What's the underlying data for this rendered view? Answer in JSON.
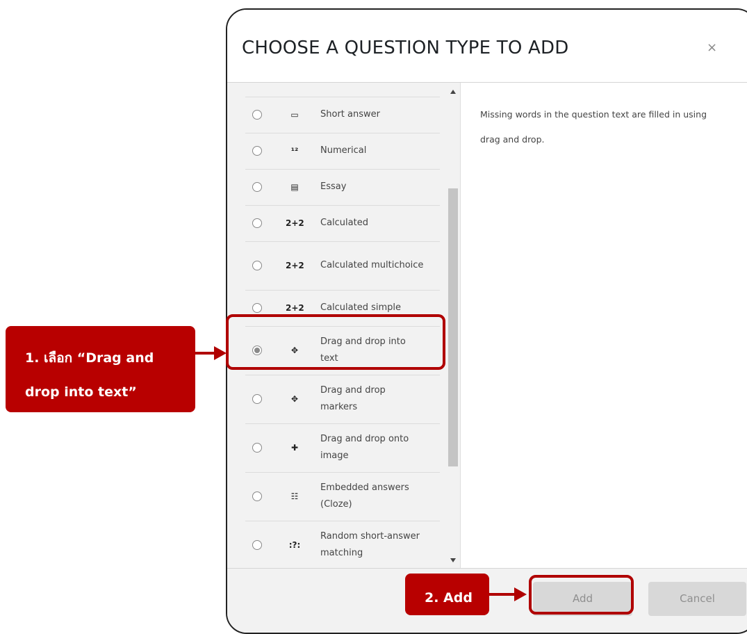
{
  "dialog": {
    "title": "CHOOSE A QUESTION TYPE TO ADD",
    "close_label": "×"
  },
  "question_types": [
    {
      "label": "Short answer",
      "icon": "short-answer-icon",
      "glyph": "▭",
      "checked": false
    },
    {
      "label": "Numerical",
      "icon": "numerical-icon",
      "glyph": "¹²",
      "checked": false
    },
    {
      "label": "Essay",
      "icon": "essay-icon",
      "glyph": "▤",
      "checked": false
    },
    {
      "label": "Calculated",
      "icon": "calculated-icon",
      "glyph": "2+2",
      "checked": false
    },
    {
      "label": "Calculated multichoice",
      "icon": "calculated-multichoice-icon",
      "glyph": "2+2",
      "checked": false
    },
    {
      "label": "Calculated simple",
      "icon": "calculated-simple-icon",
      "glyph": "2+2",
      "checked": false
    },
    {
      "label": "Drag and drop into text",
      "icon": "drag-drop-text-icon",
      "glyph": "✥",
      "checked": true
    },
    {
      "label": "Drag and drop markers",
      "icon": "drag-drop-markers-icon",
      "glyph": "✥",
      "checked": false
    },
    {
      "label": "Drag and drop onto image",
      "icon": "drag-drop-image-icon",
      "glyph": "✚",
      "checked": false
    },
    {
      "label": "Embedded answers (Cloze)",
      "icon": "cloze-icon",
      "glyph": "☷",
      "checked": false
    },
    {
      "label": "Random short-answer matching",
      "icon": "random-matching-icon",
      "glyph": ":?:",
      "checked": false
    }
  ],
  "description": "Missing words in the question text are filled in using drag and drop.",
  "footer": {
    "add_label": "Add",
    "cancel_label": "Cancel"
  },
  "annotations": {
    "step1_line1": "1. เลือก “Drag and",
    "step1_line2": "drop into text”",
    "step2": "2. Add"
  },
  "colors": {
    "annotation_red": "#b80000",
    "list_background": "#f2f2f2",
    "disabled_button": "#d8d8d8"
  }
}
